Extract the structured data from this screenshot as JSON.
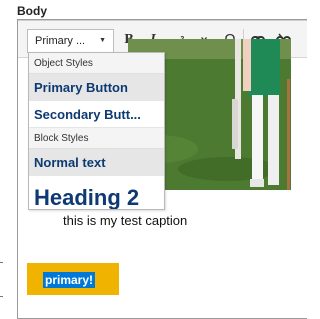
{
  "field": {
    "label": "Body"
  },
  "toolbar": {
    "style_combo_value": "Primary ...",
    "bold_label": "B",
    "italic_label": "I",
    "superscript_label": "x",
    "superscript_mark": "2",
    "subscript_label": "x",
    "subscript_mark": "2",
    "special_char_label": "Ω",
    "icons": [
      "chevron-down-icon",
      "link-icon",
      "unlink-icon"
    ]
  },
  "style_menu": {
    "group_object": "Object Styles",
    "primary_button": "Primary Button",
    "secondary_button": "Secondary Butt...",
    "group_block": "Block Styles",
    "normal_text": "Normal text",
    "heading_2": "Heading 2"
  },
  "content": {
    "caption": "this is my test caption",
    "button_text": "primary!"
  },
  "colors": {
    "menu_text": "#0d3a72",
    "button_bg": "#f0b400",
    "selection_bg": "#0078d7"
  }
}
